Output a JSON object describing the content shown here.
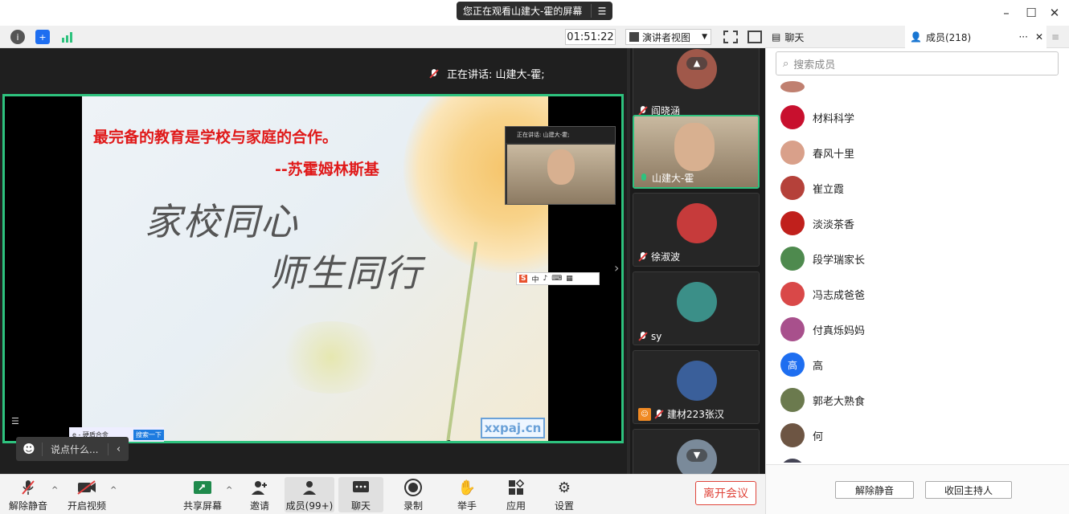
{
  "titlebar": {
    "sharing_text": "您正在观看山建大-霍的屏幕",
    "menu_icon": "list-icon",
    "minimize_icon": "minimize-icon",
    "maximize_icon": "maximize-icon",
    "close_icon": "close-icon"
  },
  "toolbar": {
    "timer": "01:51:22",
    "view_mode": "演讲者视图",
    "icons": [
      "info-icon",
      "shield-icon",
      "signal-icon",
      "fullscreen-icon",
      "sidebar-icon"
    ]
  },
  "stage": {
    "speaking_label": "正在讲话: 山建大-霍;",
    "slide": {
      "quote": "最完备的教育是学校与家庭的合作。",
      "quote_author": "--苏霍姆林斯基",
      "title1": "家校同心",
      "title2": "师生同行",
      "watermark": "xxpaj.cn"
    },
    "pip": {
      "label": "正在讲话: 山建大-霍;",
      "name": "山建大-霍"
    },
    "ime": [
      "中",
      "♪",
      "⌨",
      "▦"
    ],
    "taskbar_fragment": {
      "left": "e - 硬盾合金",
      "right": "搜索一下"
    },
    "chat_placeholder": "说点什么..."
  },
  "gallery": {
    "tiles": [
      {
        "name": "阎晓涵",
        "mic": "off",
        "avatar_color": "#a0584a"
      },
      {
        "name": "山建大-霍",
        "mic": "on",
        "avatar_color": "#b59470",
        "active": true
      },
      {
        "name": "徐淑波",
        "mic": "off",
        "avatar_color": "#c63b3b"
      },
      {
        "name": "sy",
        "mic": "off",
        "avatar_color": "#3b8f88"
      },
      {
        "name": "建材223张汉",
        "mic": "off",
        "avatar_color": "#3a5f9a"
      }
    ]
  },
  "panel": {
    "chat_tab": "聊天",
    "members_tab": "成员(218)",
    "search_placeholder": "搜索成员",
    "members": [
      {
        "name": "材料科学",
        "color": "#c8102e",
        "initial": ""
      },
      {
        "name": "春风十里",
        "color": "#d9a08a",
        "initial": ""
      },
      {
        "name": "崔立霞",
        "color": "#b5413a",
        "initial": ""
      },
      {
        "name": "淡淡茶香",
        "color": "#c0201c",
        "initial": ""
      },
      {
        "name": "段学瑞家长",
        "color": "#4e8a4e",
        "initial": ""
      },
      {
        "name": "冯志成爸爸",
        "color": "#d94848",
        "initial": ""
      },
      {
        "name": "付真烁妈妈",
        "color": "#a8508c",
        "initial": ""
      },
      {
        "name": "高",
        "color": "#1e6ef0",
        "initial": "高"
      },
      {
        "name": "郭老大熟食",
        "color": "#6b7a4e",
        "initial": ""
      },
      {
        "name": "何",
        "color": "#6d5543",
        "initial": ""
      }
    ],
    "unmute_all": "解除静音",
    "reclaim_host": "收回主持人"
  },
  "bottombar": {
    "unmute": "解除静音",
    "start_video": "开启视频",
    "share_screen": "共享屏幕",
    "invite": "邀请",
    "members": "成员(99+)",
    "chat": "聊天",
    "record": "录制",
    "raise_hand": "举手",
    "apps": "应用",
    "settings": "设置",
    "leave": "离开会议"
  },
  "colors": {
    "accent_green": "#2ec27e",
    "quote_red": "#e01919",
    "leave_red": "#e0453b",
    "blue": "#1e6ef0"
  }
}
